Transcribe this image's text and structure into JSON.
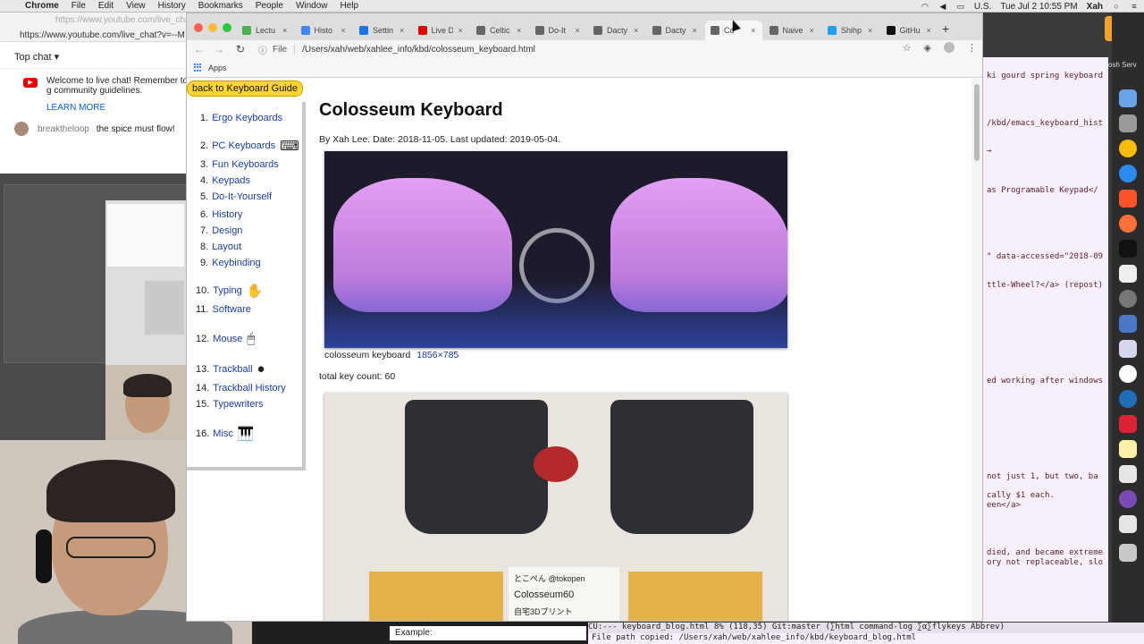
{
  "menubar": {
    "app_name": "Chrome",
    "items": [
      "File",
      "Edit",
      "View",
      "History",
      "Bookmarks",
      "People",
      "Window",
      "Help"
    ],
    "input_source": "U.S.",
    "clock": "Tue Jul 2  10:55 PM",
    "user": "Xah"
  },
  "youtube_chat": {
    "url_faded": "https://www.youtube.com/live_chat?",
    "url": "https://www.youtube.com/live_chat?v=--M",
    "top_chat_label": "Top chat",
    "welcome": "Welcome to live chat! Remember to g community guidelines.",
    "learn_more": "LEARN MORE",
    "message_user": "breaktheloop",
    "message_text": "the spice must flow!"
  },
  "chrome": {
    "tabs": [
      {
        "label": "Lectu",
        "icon_color": "#4caf50"
      },
      {
        "label": "Histo",
        "icon_color": "#4285f4"
      },
      {
        "label": "Settin",
        "icon_color": "#1a73e8"
      },
      {
        "label": "Live D",
        "icon_color": "#e00000"
      },
      {
        "label": "Celtic",
        "icon_color": "#666666"
      },
      {
        "label": "Do-It",
        "icon_color": "#666666"
      },
      {
        "label": "Dacty",
        "icon_color": "#666666"
      },
      {
        "label": "Dacty",
        "icon_color": "#666666"
      },
      {
        "label": "Co",
        "icon_color": "#666666"
      },
      {
        "label": "Naive",
        "icon_color": "#666666"
      },
      {
        "label": "Shihp",
        "icon_color": "#1da1f2"
      },
      {
        "label": "GitHu",
        "icon_color": "#111111"
      }
    ],
    "scheme_label": "File",
    "url": "/Users/xah/web/xahlee_info/kbd/colosseum_keyboard.html",
    "bookmarks_apps": "Apps"
  },
  "page": {
    "back_button": "back to Keyboard Guide",
    "toc": [
      {
        "num": "1.",
        "label": "Ergo Keyboards",
        "emoji": ""
      },
      {
        "num": "2.",
        "label": "PC Keyboards",
        "emoji": "⌨"
      },
      {
        "num": "3.",
        "label": "Fun Keyboards",
        "emoji": ""
      },
      {
        "num": "4.",
        "label": "Keypads",
        "emoji": ""
      },
      {
        "num": "5.",
        "label": "Do-It-Yourself",
        "emoji": ""
      },
      {
        "num": "6.",
        "label": "History",
        "emoji": ""
      },
      {
        "num": "7.",
        "label": "Design",
        "emoji": ""
      },
      {
        "num": "8.",
        "label": "Layout",
        "emoji": ""
      },
      {
        "num": "9.",
        "label": "Keybinding",
        "emoji": ""
      },
      {
        "num": "10.",
        "label": "Typing",
        "emoji": "✋"
      },
      {
        "num": "11.",
        "label": "Software",
        "emoji": ""
      },
      {
        "num": "12.",
        "label": "Mouse",
        "emoji": "🖱"
      },
      {
        "num": "13.",
        "label": "Trackball",
        "emoji": "●"
      },
      {
        "num": "14.",
        "label": "Trackball History",
        "emoji": ""
      },
      {
        "num": "15.",
        "label": "Typewriters",
        "emoji": ""
      },
      {
        "num": "16.",
        "label": "Misc",
        "emoji": "🎹"
      }
    ],
    "title": "Colosseum Keyboard",
    "byline": "By Xah Lee. Date: 2018-11-05. Last updated: 2019-05-04.",
    "caption": "colosseum keyboard",
    "caption_dim": "1856×785",
    "key_count": "total key count: 60",
    "card_lines": [
      "とこぺん @tokopen",
      "Colosseum60",
      "自宅3Dプリント"
    ]
  },
  "terminal": {
    "lines": [
      {
        "text": "ki gourd spring keyboard",
        "blue": false
      },
      {
        "text": "/kbd/emacs_keyboard_hist",
        "blue": false
      },
      {
        "text": "→",
        "blue": false
      },
      {
        "text": " as Programable Keypad</",
        "blue": false
      },
      {
        "text": "\" data-accessed=\"2018-09",
        "blue": false
      },
      {
        "text": "ttle-Wheel?</a> (repost)",
        "blue": false
      },
      {
        "text": "ed working after windows",
        "blue": false
      },
      {
        "text": " not just 1, but two, ba",
        "blue": false
      },
      {
        "text": "cally $1 each.",
        "blue": false
      },
      {
        "text": "een</a>",
        "blue": false
      },
      {
        "text": "died, and became extreme",
        "blue": false
      },
      {
        "text": "ory not replaceable, slo",
        "blue": false
      }
    ],
    "dock_label": "Josh Serv"
  },
  "emacs": {
    "modeline": "CU:---  keyboard_blog.html    8% (118,35)  Git:master  (∑html command-log ∑α∑flykeys Abbrev)",
    "minibuffer": "File path copied: /Users/xah/web/xahlee_info/kbd/keyboard_blog.html"
  },
  "bottom": {
    "example_label": "Example:"
  },
  "colors": {
    "link": "#1a3ca8",
    "back_button": "#ffd52e",
    "dock_bg": "#2c2c2c"
  }
}
